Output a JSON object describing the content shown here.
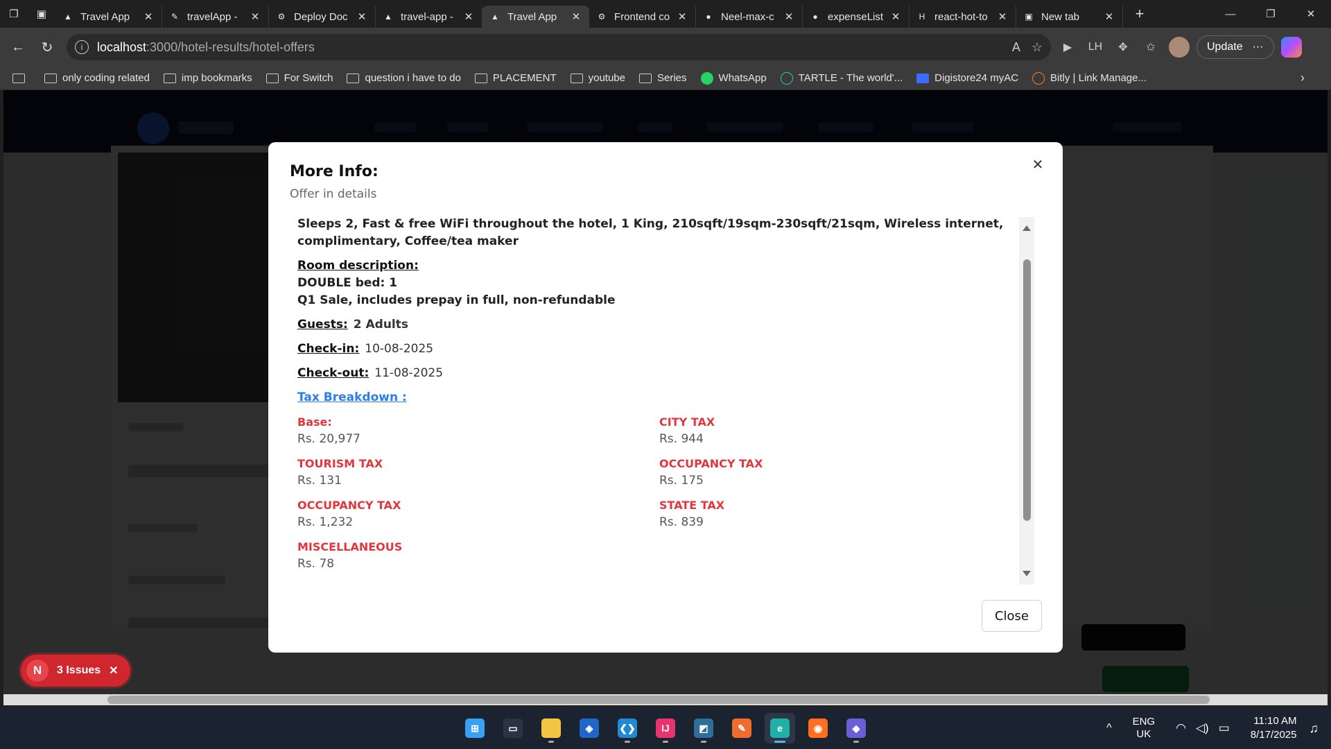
{
  "browser": {
    "tabs": [
      {
        "label": "Travel App",
        "icon": "triangle-icon",
        "active": false
      },
      {
        "label": "travelApp - ",
        "icon": "deploy-icon",
        "active": false
      },
      {
        "label": "Deploy Doc",
        "icon": "openai-icon",
        "active": false
      },
      {
        "label": "travel-app - ",
        "icon": "triangle-icon",
        "active": false
      },
      {
        "label": "Travel App",
        "icon": "triangle-icon",
        "active": true
      },
      {
        "label": "Frontend co",
        "icon": "openai-icon",
        "active": false
      },
      {
        "label": "Neel-max-c",
        "icon": "github-icon",
        "active": false
      },
      {
        "label": "expenseList",
        "icon": "github-icon",
        "active": false
      },
      {
        "label": "react-hot-to",
        "icon": "h-icon",
        "active": false
      },
      {
        "label": "New tab",
        "icon": "newtab-icon",
        "active": false
      }
    ],
    "url": {
      "host": "localhost",
      "path": ":3000/hotel-results/hotel-offers"
    },
    "update_label": "Update",
    "bookmarks": [
      {
        "label": "only coding  related",
        "icon": "folder-icon"
      },
      {
        "label": "imp bookmarks",
        "icon": "folder-icon"
      },
      {
        "label": "For Switch",
        "icon": "folder-icon"
      },
      {
        "label": "question i have to do",
        "icon": "folder-icon"
      },
      {
        "label": "PLACEMENT",
        "icon": "folder-icon"
      },
      {
        "label": "youtube",
        "icon": "folder-icon"
      },
      {
        "label": "Series",
        "icon": "folder-icon"
      },
      {
        "label": "WhatsApp",
        "icon": "whatsapp-icon"
      },
      {
        "label": "TARTLE - The world'...",
        "icon": "tartle-icon"
      },
      {
        "label": "Digistore24 myAC",
        "icon": "digistore-icon"
      },
      {
        "label": "Bitly | Link Manage...",
        "icon": "bitly-icon"
      }
    ]
  },
  "modal": {
    "title": "More Info:",
    "subtitle": "Offer in details",
    "description": "Sleeps 2, Fast & free WiFi throughout the hotel, 1 King, 210sqft/19sqm-230sqft/21sqm, Wireless internet, complimentary, Coffee/tea maker",
    "room_description_label": "Room description:",
    "room_bed": "DOUBLE bed: 1",
    "room_offer": "Q1 Sale, includes prepay in full, non-refundable",
    "guests_label": "Guests:",
    "guests_value": "2 Adults",
    "checkin_label": "Check-in:",
    "checkin_value": "10-08-2025",
    "checkout_label": "Check-out:",
    "checkout_value": "11-08-2025",
    "tax_breakdown_label": "Tax Breakdown :",
    "taxes": [
      {
        "name": "Base:",
        "value": "Rs. 20,977"
      },
      {
        "name": "CITY TAX",
        "value": "Rs. 944"
      },
      {
        "name": "TOURISM TAX",
        "value": "Rs. 131"
      },
      {
        "name": "OCCUPANCY TAX",
        "value": "Rs. 175"
      },
      {
        "name": "OCCUPANCY TAX",
        "value": "Rs. 1,232"
      },
      {
        "name": "STATE TAX",
        "value": "Rs. 839"
      },
      {
        "name": "MISCELLANEOUS",
        "value": "Rs. 78"
      }
    ],
    "close_label": "Close"
  },
  "issues_badge": {
    "logo": "N",
    "label": "3 Issues"
  },
  "taskbar": {
    "apps": [
      {
        "name": "windows-start-icon",
        "color": "#3aa0f3",
        "glyph": "⊞",
        "active": false,
        "running": false
      },
      {
        "name": "task-manager-icon",
        "color": "#2b3445",
        "glyph": "▭",
        "active": false,
        "running": false
      },
      {
        "name": "file-explorer-icon",
        "color": "#f4c542",
        "glyph": "",
        "active": false,
        "running": true
      },
      {
        "name": "shield-app-icon",
        "color": "#1f66c8",
        "glyph": "◈",
        "active": false,
        "running": false
      },
      {
        "name": "vscode-icon",
        "color": "#1f8ad2",
        "glyph": "❮❯",
        "active": false,
        "running": true
      },
      {
        "name": "intellij-icon",
        "color": "#e8346e",
        "glyph": "IJ",
        "active": false,
        "running": true
      },
      {
        "name": "mysql-workbench-icon",
        "color": "#2d6f9a",
        "glyph": "◩",
        "active": false,
        "running": true
      },
      {
        "name": "postman-icon",
        "color": "#ef6c2f",
        "glyph": "✎",
        "active": false,
        "running": false
      },
      {
        "name": "edge-icon",
        "color": "#1fb0a8",
        "glyph": "e",
        "active": true,
        "running": true
      },
      {
        "name": "firefox-icon",
        "color": "#ff6f1f",
        "glyph": "◉",
        "active": false,
        "running": false
      },
      {
        "name": "git-icon",
        "color": "#6a5fd6",
        "glyph": "◆",
        "active": false,
        "running": true
      }
    ],
    "lang_line1": "ENG",
    "lang_line2": "UK",
    "time": "11:10 AM",
    "date": "8/17/2025"
  }
}
